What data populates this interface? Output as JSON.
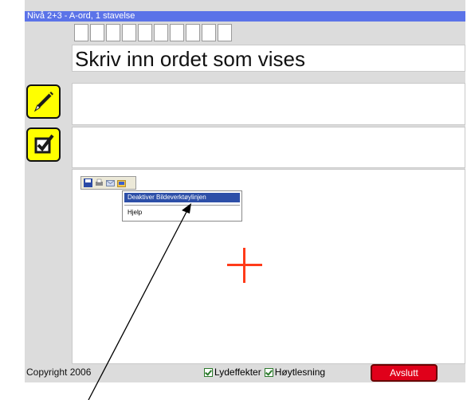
{
  "title": "Nivå 2+3 - A-ord, 1 stavelse",
  "letter_boxes": [
    "",
    "",
    "",
    "",
    "",
    "",
    "",
    "",
    "",
    ""
  ],
  "prompt": "Skriv inn ordet som vises",
  "image_toolbar": {
    "icons": [
      "save-icon",
      "print-icon",
      "email-icon",
      "folder-icon"
    ]
  },
  "context_menu": {
    "items": [
      "Deaktiver Bildeverktøylinjen",
      "Hjelp"
    ]
  },
  "footer": {
    "copyright": "Copyright 2006",
    "sound_effects": "Lydeffekter",
    "read_aloud": "Høytlesning",
    "exit": "Avslutt"
  },
  "colors": {
    "title_bar": "#5b73e8",
    "icon_button": "#ffff00",
    "cross": "#ff3b1a",
    "exit_button": "#e0001a"
  }
}
